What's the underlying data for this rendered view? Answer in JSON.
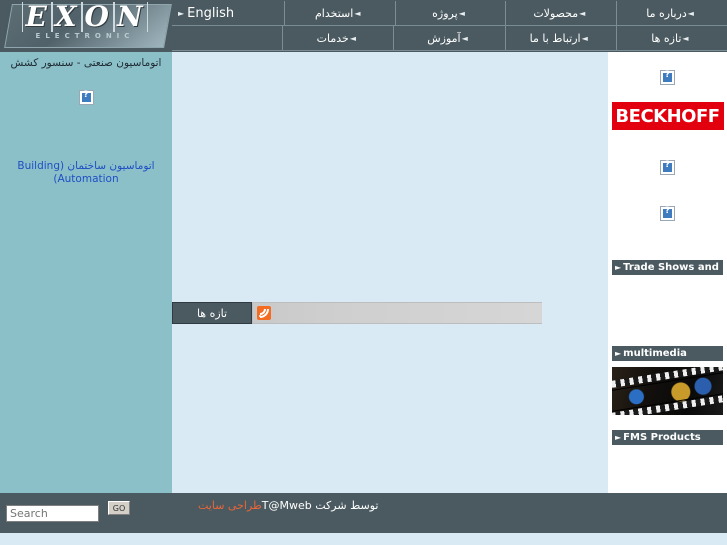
{
  "site": {
    "logo_text": "EXON",
    "logo_sub": "ELECTRONIC"
  },
  "nav": {
    "row1": [
      {
        "label": "درباره ما",
        "icon": "triangle-left-icon"
      },
      {
        "label": "محصولات",
        "icon": "triangle-left-icon"
      },
      {
        "label": "پروژه",
        "icon": "triangle-left-icon"
      },
      {
        "label": "استخدام",
        "icon": "triangle-left-icon"
      },
      {
        "label": "English",
        "icon": "triangle-right-icon"
      }
    ],
    "row2": [
      {
        "label": "تازه ها",
        "icon": "triangle-left-icon"
      },
      {
        "label": "ارتباط با ما",
        "icon": "triangle-left-icon"
      },
      {
        "label": "آموزش",
        "icon": "triangle-left-icon"
      },
      {
        "label": "خدمات",
        "icon": "triangle-left-icon"
      },
      {
        "label": "",
        "icon": ""
      }
    ]
  },
  "left_sidebar": {
    "title": "اتوماسیون صنعتی - سنسور کشش",
    "broken_image": "broken-image-icon",
    "link": "اتوماسیون ساختمان (Building Automation)"
  },
  "main": {
    "news_tab_label": "تازه ها",
    "rss_icon": "rss-feed-icon"
  },
  "right_sidebar": {
    "broken_image_top": "broken-image-icon",
    "beckhoff_label": "BECKHOFF",
    "broken_image_mid": "broken-image-icon",
    "broken_image_low": "broken-image-icon",
    "trade_shows_label": "Trade Shows and Events",
    "multimedia_label": "multimedia",
    "multimedia_image": "filmstrip-image",
    "fms_label": "FMS Products"
  },
  "footer": {
    "search_placeholder": "Search",
    "search_value": "",
    "go_label": "GO",
    "credit_link": "طراحی سایت",
    "credit_rest": "توسط شرکت T@Mweb"
  },
  "colors": {
    "header_bg": "#4a5a60",
    "left_sidebar_bg": "#8cc0c9",
    "main_bg": "#daeaf5",
    "beckhoff_red": "#e2000f",
    "link_blue": "#1f4fc4",
    "credit_orange": "#e8663a",
    "rss_orange": "#f36c21"
  }
}
